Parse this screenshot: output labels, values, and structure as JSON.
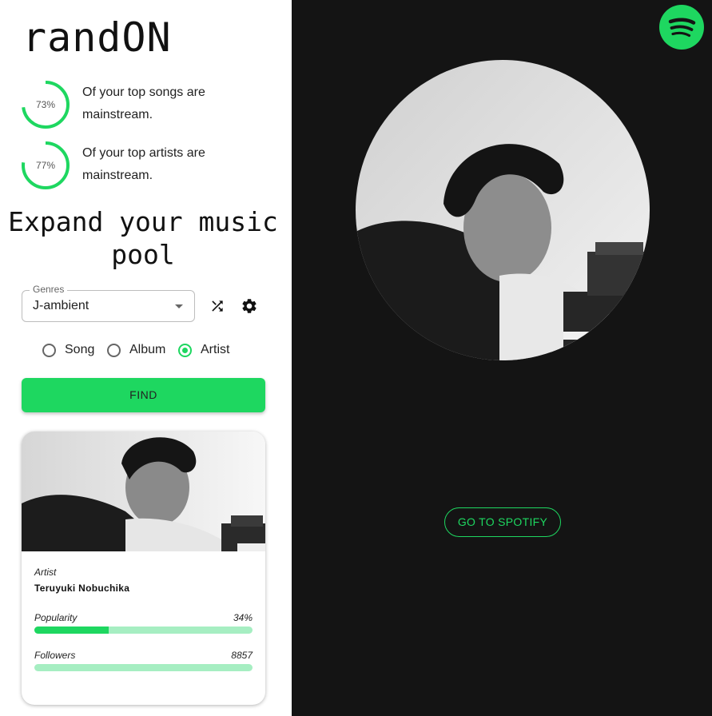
{
  "app": {
    "title": "randON"
  },
  "stats": [
    {
      "percent": 73,
      "percent_label": "73%",
      "text": "Of your top songs are mainstream."
    },
    {
      "percent": 77,
      "percent_label": "77%",
      "text": "Of your top artists are mainstream."
    }
  ],
  "headline": "Expand your music pool",
  "genres": {
    "label": "Genres",
    "value": "J-ambient"
  },
  "icons": {
    "shuffle": "shuffle-icon",
    "settings": "gear-icon",
    "spotify": "spotify-logo"
  },
  "search_type": {
    "options": [
      {
        "label": "Song",
        "selected": false
      },
      {
        "label": "Album",
        "selected": false
      },
      {
        "label": "Artist",
        "selected": true
      }
    ]
  },
  "find_button": "FIND",
  "result": {
    "kind": "Artist",
    "name": "Teruyuki Nobuchika",
    "popularity": {
      "label": "Popularity",
      "value_label": "34%",
      "value": 0.34
    },
    "followers": {
      "label": "Followers",
      "value_label": "8857",
      "value": 0.0
    }
  },
  "go_button": "GO TO SPOTIFY",
  "colors": {
    "accent": "#1ed760",
    "accent_light": "#a6eec2",
    "dark_panel": "#141414"
  }
}
